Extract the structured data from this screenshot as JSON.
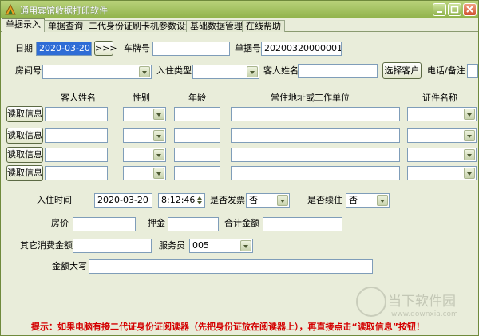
{
  "window": {
    "title": "通用宾馆收据打印软件"
  },
  "tabs": [
    "单据录入",
    "单据查询",
    "二代身份证刷卡机参数设置",
    "基础数据管理",
    "在线帮助"
  ],
  "header": {
    "date_label": "日期",
    "date_value": "2020-03-20",
    "date_btn": ">>>",
    "plate_label": "车牌号",
    "plate_value": "",
    "receipt_label": "单据号",
    "receipt_value": "20200320000001",
    "room_label": "房间号",
    "room_value": "",
    "checkin_type_label": "入住类型",
    "checkin_type_value": "",
    "guest_name_label": "客人姓名",
    "guest_name_value": "",
    "select_guest_btn": "选择客户",
    "phone_label": "电话/备注",
    "phone_value": ""
  },
  "guests": {
    "headers": {
      "name": "客人姓名",
      "gender": "性别",
      "age": "年龄",
      "address": "常住地址或工作单位",
      "id_type": "证件名称"
    },
    "read_btn": "读取信息",
    "rows": [
      {
        "name": "",
        "gender": "",
        "age": "",
        "address": "",
        "id_type": ""
      },
      {
        "name": "",
        "gender": "",
        "age": "",
        "address": "",
        "id_type": ""
      },
      {
        "name": "",
        "gender": "",
        "age": "",
        "address": "",
        "id_type": ""
      },
      {
        "name": "",
        "gender": "",
        "age": "",
        "address": "",
        "id_type": ""
      }
    ]
  },
  "stay": {
    "checkin_time_label": "入住时间",
    "checkin_date": "2020-03-20",
    "checkin_time": "8:12:46",
    "invoice_label": "是否发票",
    "invoice_value": "否",
    "continue_label": "是否续住",
    "continue_value": "否",
    "room_price_label": "房价",
    "room_price_value": "",
    "deposit_label": "押金",
    "deposit_value": "",
    "total_label": "合计金额",
    "total_value": "",
    "other_label": "其它消费金额",
    "other_value": "",
    "waiter_label": "服务员",
    "waiter_value": "005",
    "amount_words_label": "金额大写",
    "amount_words_value": ""
  },
  "tip": "提示：如果电脑有接二代证身份证阅读器（先把身份证放在阅读器上），再直接点击“读取信息”按钮！",
  "watermark": {
    "text": "当下软件园",
    "url": "www.downxia.com"
  }
}
